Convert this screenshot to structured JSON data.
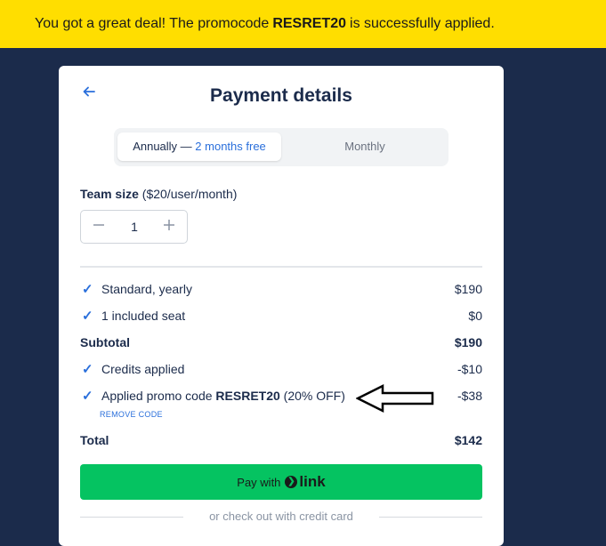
{
  "banner": {
    "prefix": "You got a great deal! The promocode",
    "code": "RESRET20",
    "suffix": "is successfully applied."
  },
  "card": {
    "title": "Payment details",
    "back_icon": "arrow-left-icon"
  },
  "billing_toggle": {
    "annual_label": "Annually —",
    "annual_badge": "2 months free",
    "monthly_label": "Monthly",
    "selected": "Annually"
  },
  "team": {
    "label_bold": "Team size",
    "label_rest": "($20/user/month)",
    "quantity": "1"
  },
  "summary": {
    "items": [
      {
        "label": "Standard, yearly",
        "amount": "$190"
      },
      {
        "label": "1 included seat",
        "amount": "$0"
      }
    ],
    "subtotal": {
      "label": "Subtotal",
      "amount": "$190"
    },
    "credits": {
      "label": "Credits applied",
      "amount": "-$10"
    },
    "promo": {
      "prefix": "Applied promo code",
      "code": "RESRET20",
      "suffix": "(20% OFF)",
      "amount": "-$38",
      "remove_label": "REMOVE CODE"
    },
    "total": {
      "label": "Total",
      "amount": "$142"
    }
  },
  "pay": {
    "label": "Pay with",
    "brand": "link"
  },
  "alt_checkout": "or check out with credit card",
  "colors": {
    "banner": "#ffde00",
    "background": "#1b2b4b",
    "accent": "#2a6fdb",
    "pay_button": "#05c361"
  }
}
